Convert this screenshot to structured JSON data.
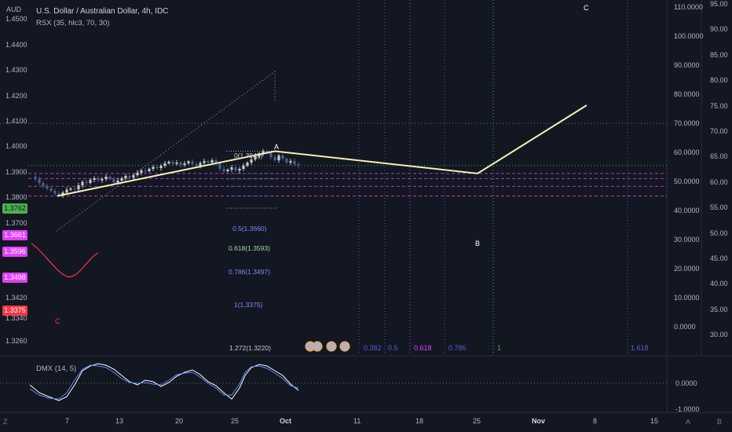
{
  "header": {
    "symbol_title": "U.S. Dollar / Australian Dollar, 4h, IDC",
    "indicator_main": "RSX (35, hlc3, 70, 30)",
    "currency": "AUD",
    "indicator_sub": "DMX (14, 5)"
  },
  "colors": {
    "background": "#131722",
    "candle_up": "#c8c8c8",
    "candle_down": "#4a5f8f",
    "wave_line": "#f5f0b5",
    "dashed_magenta": "#b03fb0",
    "dotted_blue": "#3f5fb0",
    "dotted_green": "#4caf50",
    "last_price": "#4caf50",
    "red_tag": "#f23645",
    "magenta_tag": "#e040fb"
  },
  "left_axis": {
    "ticks": [
      "1.4500",
      "1.4400",
      "1.4300",
      "1.4200",
      "1.4100",
      "1.4000",
      "1.3900",
      "1.3800",
      "1.3700",
      "1.3420",
      "1.3340",
      "1.3260"
    ],
    "tags": [
      {
        "label": "1.3762",
        "kind": "last"
      },
      {
        "label": "1.3661",
        "kind": "magenta"
      },
      {
        "label": "1.3596",
        "kind": "magenta"
      },
      {
        "label": "1.3498",
        "kind": "magenta"
      },
      {
        "label": "1.3375",
        "kind": "red"
      }
    ]
  },
  "right_axis_inner": [
    "110.0000",
    "100.0000",
    "90.0000",
    "80.0000",
    "70.0000",
    "60.0000",
    "50.0000",
    "40.0000",
    "30.0000",
    "20.0000",
    "10.0000",
    "0.0000"
  ],
  "right_axis_outer": [
    "95.00",
    "90.00",
    "85.00",
    "80.00",
    "75.00",
    "70.00",
    "65.00",
    "60.00",
    "55.00",
    "50.00",
    "45.00",
    "40.00",
    "35.00",
    "30.00"
  ],
  "sub_axis": [
    "0.0000",
    "-1.0000"
  ],
  "x_axis": [
    "7",
    "13",
    "20",
    "25",
    "Oct",
    "11",
    "18",
    "25",
    "Nov",
    "8",
    "15"
  ],
  "wave_labels": {
    "c_low": "C",
    "a": "A",
    "b": "B",
    "c_high": "C"
  },
  "fib_labels": [
    "0(1.3945)",
    "0.5(1.3660)",
    "0.618(1.3593)",
    "0.786(1.3497)",
    "1(1.3375)",
    "1.272(1.3220)"
  ],
  "time_fibs": [
    {
      "label": "0.382",
      "color": "#5b5bd6"
    },
    {
      "label": "0.5",
      "color": "#5b5bd6"
    },
    {
      "label": "0.618",
      "color": "#e040fb"
    },
    {
      "label": "0.786",
      "color": "#5b5bd6"
    },
    {
      "label": "1",
      "color": "#4caf50"
    },
    {
      "label": "1.618",
      "color": "#5b5bd6"
    }
  ],
  "corner": {
    "gear": "Z",
    "auto": "A",
    "log": "B"
  },
  "chart_data": {
    "type": "line",
    "title": "U.S. Dollar / Australian Dollar, 4h, IDC",
    "price_range": [
      1.326,
      1.455
    ],
    "last_price": 1.3762,
    "swing_path": [
      {
        "label": "C",
        "price": 1.3375
      },
      {
        "label": "A",
        "price": 1.3945
      },
      {
        "label": "B",
        "price": 1.3661
      },
      {
        "label": "C",
        "price": 1.453
      }
    ],
    "fib_levels": [
      {
        "ratio": 0,
        "price": 1.3945
      },
      {
        "ratio": 0.5,
        "price": 1.366
      },
      {
        "ratio": 0.618,
        "price": 1.3593
      },
      {
        "ratio": 0.786,
        "price": 1.3497
      },
      {
        "ratio": 1,
        "price": 1.3375
      },
      {
        "ratio": 1.272,
        "price": 1.322
      }
    ],
    "horizontal_levels": [
      1.3661,
      1.3596,
      1.3498,
      1.3375
    ],
    "price_series": [
      1.362,
      1.359,
      1.354,
      1.35,
      1.347,
      1.344,
      1.3405,
      1.3385,
      1.342,
      1.3455,
      1.347,
      1.346,
      1.351,
      1.3555,
      1.354,
      1.358,
      1.36,
      1.3575,
      1.359,
      1.362,
      1.359,
      1.3545,
      1.357,
      1.36,
      1.363,
      1.361,
      1.364,
      1.367,
      1.37,
      1.369,
      1.372,
      1.3745,
      1.373,
      1.376,
      1.379,
      1.381,
      1.3785,
      1.38,
      1.377,
      1.379,
      1.3815,
      1.378,
      1.376,
      1.3795,
      1.382,
      1.38,
      1.383,
      1.379,
      1.372,
      1.369,
      1.371,
      1.374,
      1.37,
      1.372,
      1.376,
      1.38,
      1.384,
      1.388,
      1.391,
      1.3945,
      1.392,
      1.387,
      1.383,
      1.389,
      1.385,
      1.38,
      1.382,
      1.378,
      1.3762
    ]
  }
}
